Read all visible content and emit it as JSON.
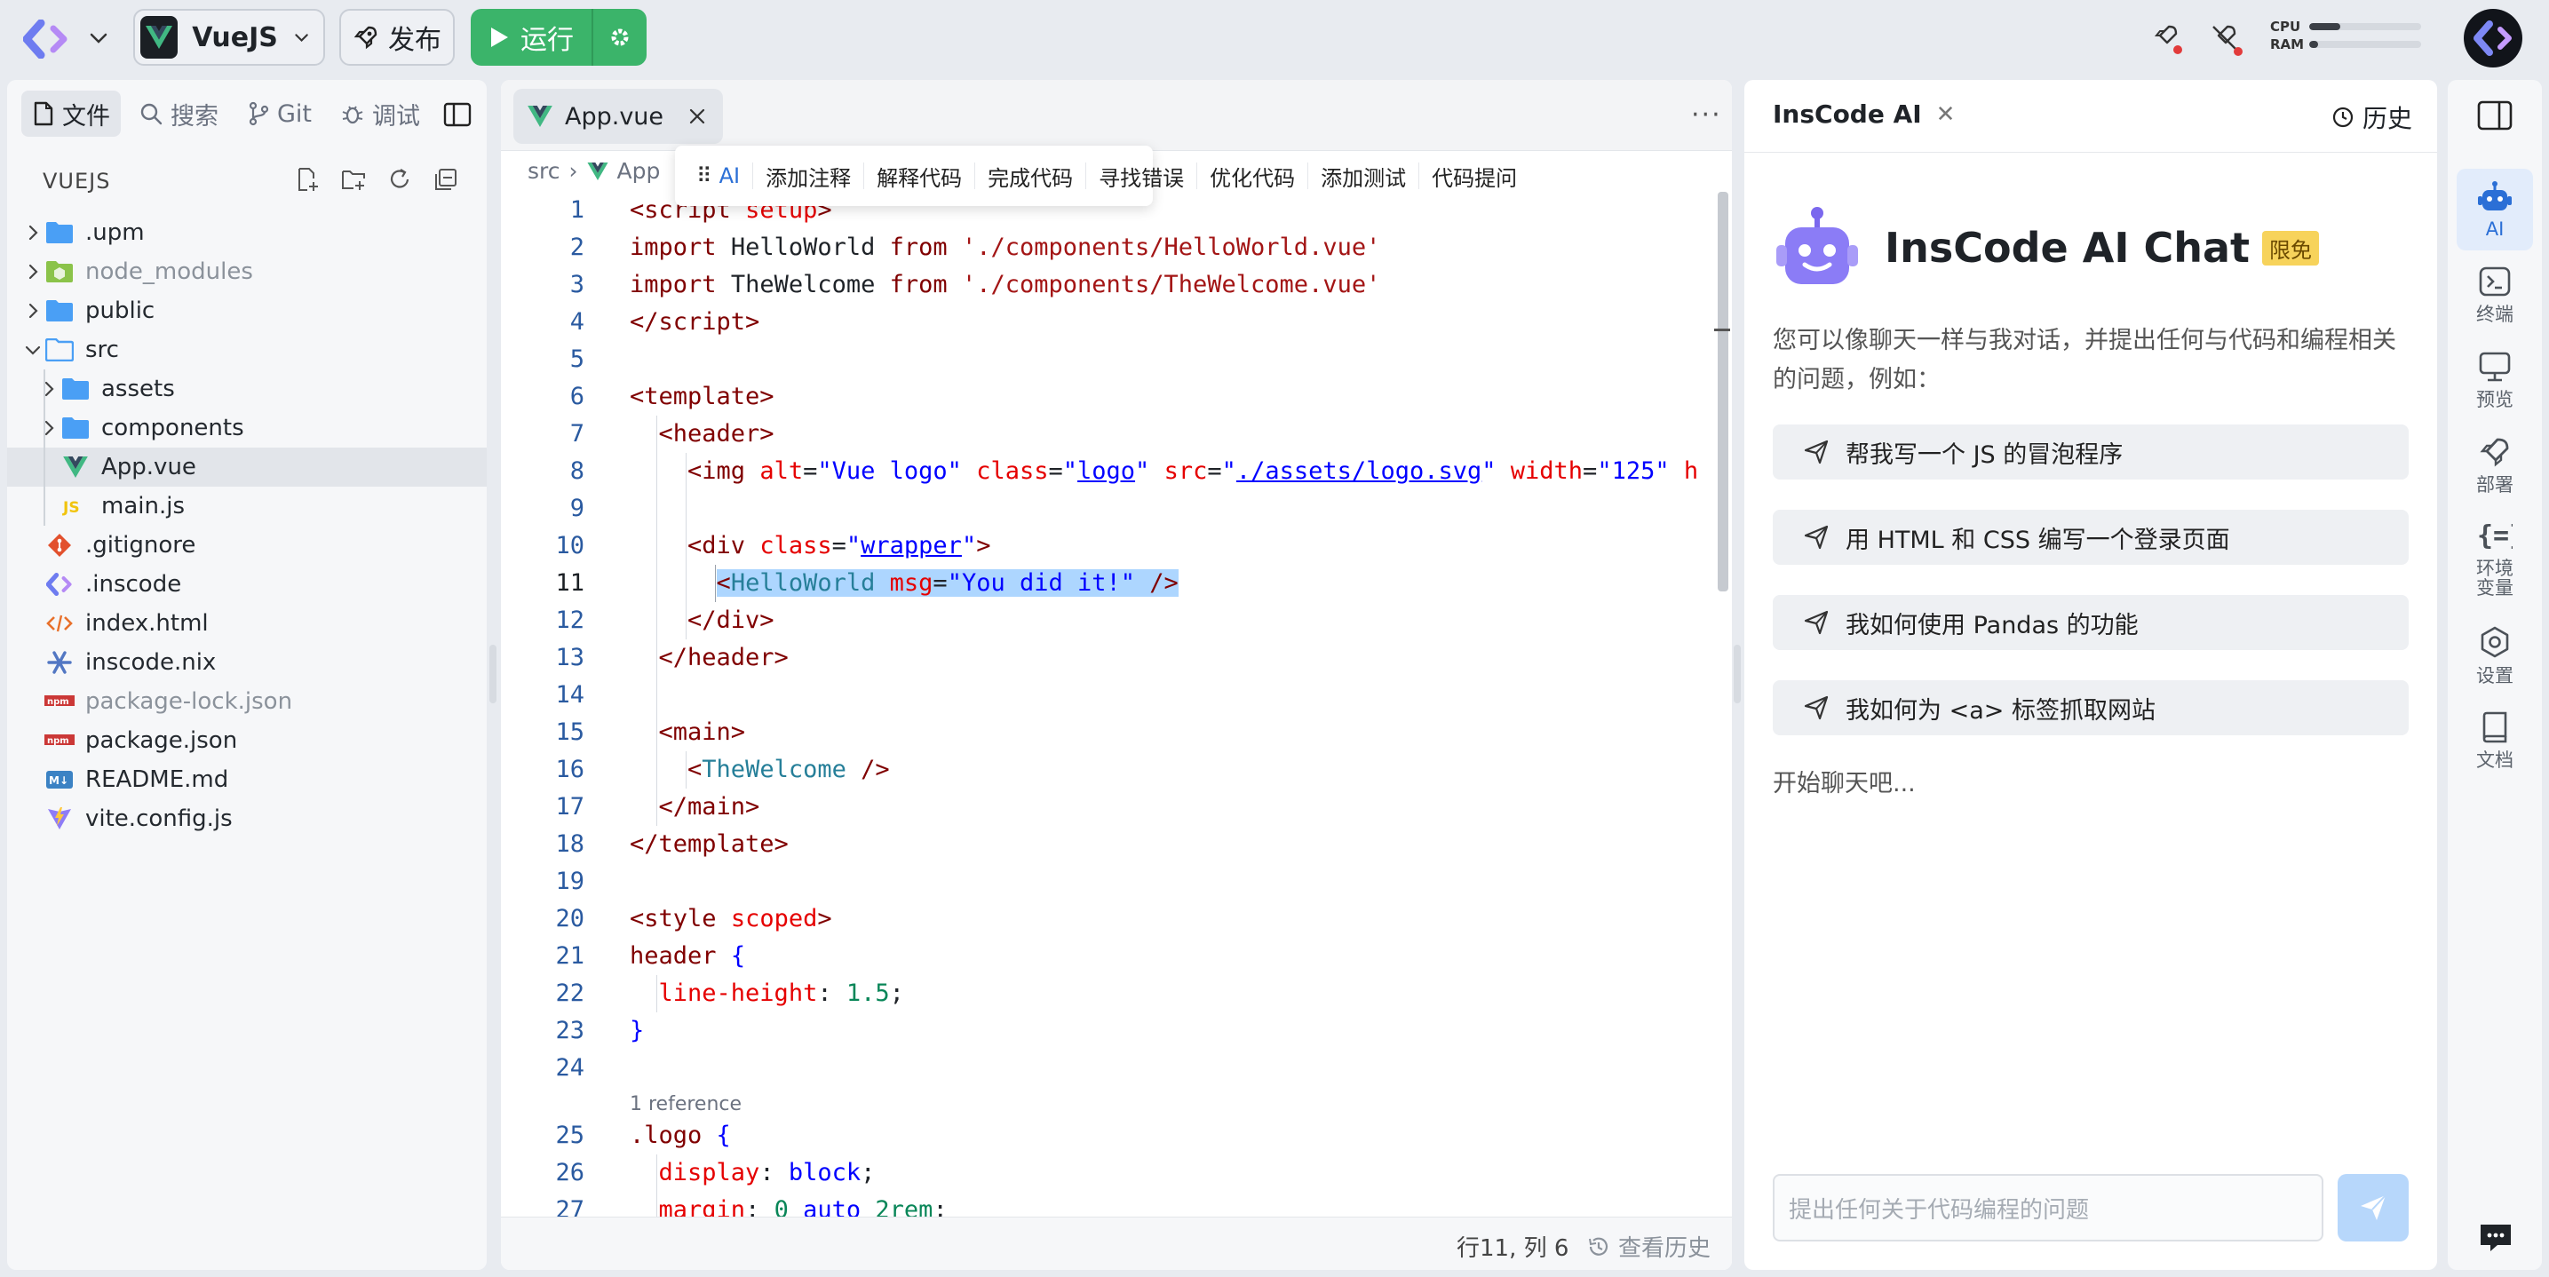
{
  "topbar": {
    "project_name": "VueJS",
    "publish_label": "发布",
    "run_label": "运行",
    "cpu_label": "CPU",
    "ram_label": "RAM",
    "cpu_usage": 0.28,
    "ram_usage": 0.08
  },
  "sidebar": {
    "tabs": [
      {
        "label": "文件",
        "icon": "file-icon"
      },
      {
        "label": "搜索",
        "icon": "search-icon"
      },
      {
        "label": "Git",
        "icon": "git-branch-icon"
      },
      {
        "label": "调试",
        "icon": "bug-icon"
      }
    ],
    "explorer_title": "VUEJS",
    "tree": [
      {
        "name": ".upm",
        "type": "folder",
        "depth": 0,
        "expanded": false
      },
      {
        "name": "node_modules",
        "type": "folder-node",
        "depth": 0,
        "expanded": false,
        "dim": true
      },
      {
        "name": "public",
        "type": "folder",
        "depth": 0,
        "expanded": false
      },
      {
        "name": "src",
        "type": "folder-open",
        "depth": 0,
        "expanded": true
      },
      {
        "name": "assets",
        "type": "folder",
        "depth": 1,
        "expanded": false
      },
      {
        "name": "components",
        "type": "folder",
        "depth": 1,
        "expanded": false
      },
      {
        "name": "App.vue",
        "type": "vue",
        "depth": 1,
        "selected": true
      },
      {
        "name": "main.js",
        "type": "js",
        "depth": 1
      },
      {
        "name": ".gitignore",
        "type": "git",
        "depth": 0
      },
      {
        "name": ".inscode",
        "type": "inscode",
        "depth": 0
      },
      {
        "name": "index.html",
        "type": "html",
        "depth": 0
      },
      {
        "name": "inscode.nix",
        "type": "nix",
        "depth": 0
      },
      {
        "name": "package-lock.json",
        "type": "npm",
        "depth": 0,
        "dim": true
      },
      {
        "name": "package.json",
        "type": "npm",
        "depth": 0
      },
      {
        "name": "README.md",
        "type": "md",
        "depth": 0
      },
      {
        "name": "vite.config.js",
        "type": "vite",
        "depth": 0
      }
    ]
  },
  "editor": {
    "tab_label": "App.vue",
    "breadcrumb": [
      "src",
      "App"
    ],
    "ai_toolbar": [
      "AI",
      "添加注释",
      "解释代码",
      "完成代码",
      "寻找错误",
      "优化代码",
      "添加测试",
      "代码提问"
    ],
    "reference_text": "1 reference",
    "line_numbers": [
      "1",
      "2",
      "3",
      "4",
      "5",
      "6",
      "7",
      "8",
      "9",
      "10",
      "11",
      "12",
      "13",
      "14",
      "15",
      "16",
      "17",
      "18",
      "19",
      "20",
      "21",
      "22",
      "23",
      "24",
      "25",
      "26",
      "27"
    ],
    "status_position": "行11, 列 6",
    "status_history": "查看历史"
  },
  "chat": {
    "panel_title": "InsCode AI",
    "history_label": "历史",
    "hero_title": "InsCode AI Chat",
    "free_badge": "限免",
    "intro": "您可以像聊天一样与我对话，并提出任何与代码和编程相关的问题，例如：",
    "suggestions": [
      "帮我写一个 JS 的冒泡程序",
      "用 HTML 和 CSS 编写一个登录页面",
      "我如何使用 Pandas 的功能",
      "我如何为 <a> 标签抓取网站"
    ],
    "start_text": "开始聊天吧...",
    "input_placeholder": "提出任何关于代码编程的问题"
  },
  "rail": [
    {
      "label": "AI",
      "icon": "robot-icon",
      "active": true
    },
    {
      "label": "终端",
      "icon": "terminal-icon"
    },
    {
      "label": "预览",
      "icon": "monitor-icon"
    },
    {
      "label": "部署",
      "icon": "rocket-icon"
    },
    {
      "label": "环境\n变量",
      "icon": "braces-icon"
    },
    {
      "label": "设置",
      "icon": "settings-icon"
    },
    {
      "label": "文档",
      "icon": "book-icon"
    }
  ],
  "colors": {
    "run_green": "#3bb46a",
    "accent_blue": "#2b6fd6",
    "selection": "#add6ff",
    "free_badge_yellow": "#f7d35b"
  }
}
